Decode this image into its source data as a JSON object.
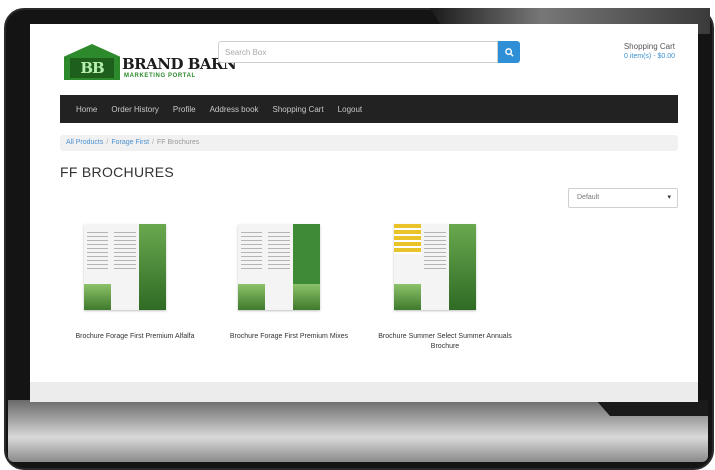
{
  "brand": {
    "logo_mark": "BB",
    "name": "BRAND BARN",
    "tagline": "MARKETING PORTAL"
  },
  "search": {
    "placeholder": "Search Box",
    "icon": "search-icon"
  },
  "cart": {
    "title": "Shopping Cart",
    "summary": "0 item(s) - $0.00"
  },
  "nav": {
    "items": [
      {
        "label": "Home"
      },
      {
        "label": "Order History"
      },
      {
        "label": "Profile"
      },
      {
        "label": "Address book"
      },
      {
        "label": "Shopping Cart"
      },
      {
        "label": "Logout"
      }
    ]
  },
  "breadcrumb": {
    "items": [
      {
        "label": "All Products"
      },
      {
        "label": "Forage First"
      },
      {
        "label": "FF Brochures"
      }
    ],
    "separator": "/"
  },
  "page": {
    "title": "FF BROCHURES"
  },
  "sort": {
    "selected": "Default",
    "caret": "▾"
  },
  "products": [
    {
      "name": "Brochure Forage First Premium Alfalfa"
    },
    {
      "name": "Brochure Forage First Premium Mixes"
    },
    {
      "name": "Brochure Summer Select Summer Annuals Brochure"
    }
  ],
  "colors": {
    "brand_green": "#2c8a2c",
    "navbar": "#222222",
    "link_blue": "#4a90d0",
    "search_button": "#2f8fd6"
  }
}
